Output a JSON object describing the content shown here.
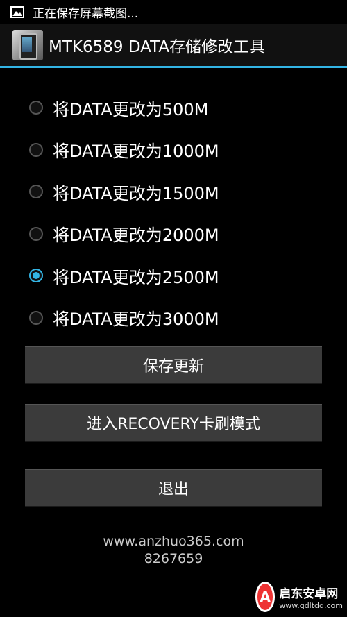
{
  "status_bar": {
    "icon": "gallery-icon",
    "text": "正在保存屏幕截图..."
  },
  "title_bar": {
    "app_icon": "app-icon",
    "title": "MTK6589 DATA存储修改工具"
  },
  "options": [
    {
      "label": "将DATA更改为500M",
      "checked": false
    },
    {
      "label": "将DATA更改为1000M",
      "checked": false
    },
    {
      "label": "将DATA更改为1500M",
      "checked": false
    },
    {
      "label": "将DATA更改为2000M",
      "checked": false
    },
    {
      "label": "将DATA更改为2500M",
      "checked": true
    },
    {
      "label": "将DATA更改为3000M",
      "checked": false
    }
  ],
  "buttons": {
    "save": "保存更新",
    "recovery": "进入RECOVERY卡刷模式",
    "exit": "退出"
  },
  "footer": {
    "website": "www.anzhuo365.com",
    "number": "8267659"
  },
  "watermark": {
    "name": "启东安卓网",
    "url": "www.qdltdq.com"
  },
  "colors": {
    "accent": "#33b5e5",
    "background": "#000000",
    "button": "#3b3b3b"
  }
}
